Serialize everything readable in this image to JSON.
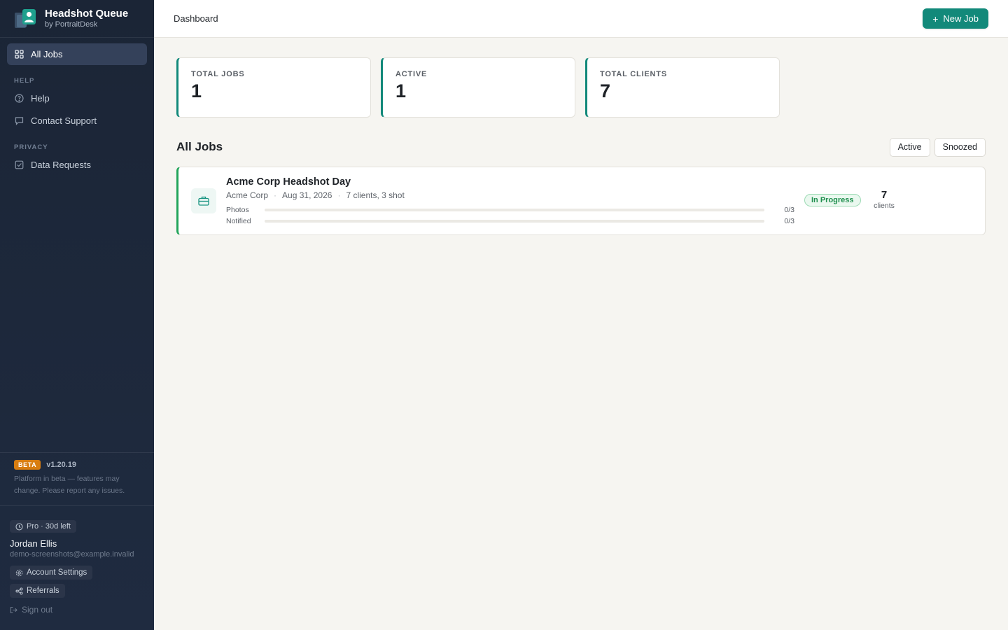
{
  "brand": {
    "title": "Headshot Queue",
    "subtitle": "by PortraitDesk"
  },
  "sidebar": {
    "items": [
      {
        "label": "All Jobs",
        "icon": "grid-icon",
        "active": true
      }
    ],
    "help_section": "HELP",
    "help_items": [
      {
        "label": "Help",
        "icon": "help-circle-icon"
      },
      {
        "label": "Contact Support",
        "icon": "chat-bubble-icon"
      }
    ],
    "privacy_section": "PRIVACY",
    "privacy_items": [
      {
        "label": "Data Requests",
        "icon": "checkbox-icon"
      }
    ]
  },
  "beta": {
    "badge": "BETA",
    "version": "v1.20.19",
    "note": "Platform in beta — features may change. Please report any issues."
  },
  "user": {
    "plan": "Pro · 30d left",
    "name": "Jordan Ellis",
    "email": "demo-screenshots@example.invalid",
    "account_settings": "Account Settings",
    "referrals": "Referrals",
    "sign_out": "Sign out"
  },
  "topbar": {
    "breadcrumb": "Dashboard",
    "new_job_label": "New Job"
  },
  "stats": [
    {
      "label": "TOTAL JOBS",
      "value": "1"
    },
    {
      "label": "ACTIVE",
      "value": "1"
    },
    {
      "label": "TOTAL CLIENTS",
      "value": "7"
    }
  ],
  "jobs_section": {
    "title": "All Jobs",
    "filters": [
      "Active",
      "Snoozed"
    ]
  },
  "jobs": [
    {
      "title": "Acme Corp Headshot Day",
      "client": "Acme Corp",
      "date": "Aug 31, 2026",
      "summary": "7 clients, 3 shot",
      "progress": [
        {
          "label": "Photos",
          "count": "0/3",
          "fraction": 0
        },
        {
          "label": "Notified",
          "count": "0/3",
          "fraction": 0
        }
      ],
      "status": "In Progress",
      "client_count": "7",
      "client_count_label": "clients"
    }
  ],
  "colors": {
    "accent": "#12897a",
    "status_green": "#22a45a",
    "beta_orange": "#d87d10",
    "sidebar_bg": "#1b2536"
  }
}
